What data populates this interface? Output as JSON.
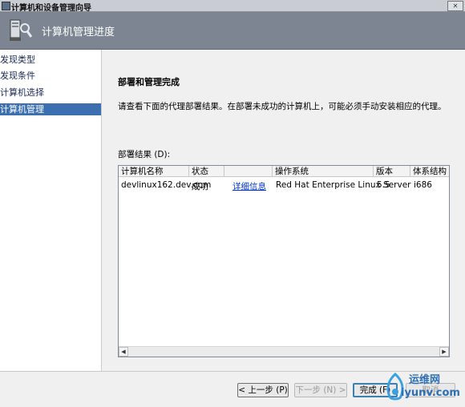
{
  "window": {
    "title": "计算机和设备管理向导",
    "close_glyph": "✕"
  },
  "header": {
    "title": "计算机管理进度",
    "icon": "computer-wizard-icon"
  },
  "sidebar": {
    "items": [
      {
        "label": "发现类型",
        "active": false
      },
      {
        "label": "发现条件",
        "active": false
      },
      {
        "label": "计算机选择",
        "active": false
      },
      {
        "label": "计算机管理",
        "active": true
      }
    ]
  },
  "main": {
    "section_title": "部署和管理完成",
    "instruction": "请查看下面的代理部署结果。在部署未成功的计算机上，可能必须手动安装相应的代理。",
    "results_label": "部署结果 (D):",
    "table": {
      "columns": [
        "计算机名称",
        "状态",
        "",
        "操作系统",
        "版本",
        "体系结构"
      ],
      "rows": [
        {
          "name": "devlinux162.dev.com",
          "status": "成功",
          "detail": "详细信息",
          "os": "Red Hat Enterprise Linux Server",
          "version": "5.5",
          "arch": "i686"
        }
      ]
    }
  },
  "buttons": {
    "back": "< 上一步 (P)",
    "next": "下一步 (N) >",
    "finish": "完成 (F)",
    "cancel": "取消"
  },
  "watermark": {
    "line1": "运维网",
    "line2": "iyunv.com"
  },
  "colors": {
    "header": "#7c8591",
    "active_nav": "#3b6faf",
    "link": "#0033cc"
  }
}
